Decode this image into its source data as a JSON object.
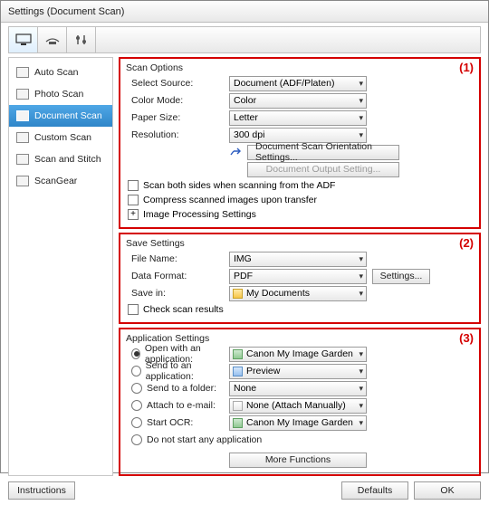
{
  "window": {
    "title": "Settings (Document Scan)"
  },
  "sidebar": {
    "items": [
      {
        "label": "Auto Scan"
      },
      {
        "label": "Photo Scan"
      },
      {
        "label": "Document Scan"
      },
      {
        "label": "Custom Scan"
      },
      {
        "label": "Scan and Stitch"
      },
      {
        "label": "ScanGear"
      }
    ]
  },
  "panel_numbers": {
    "p1": "(1)",
    "p2": "(2)",
    "p3": "(3)"
  },
  "scan_options": {
    "heading": "Scan Options",
    "select_source_label": "Select Source:",
    "select_source_value": "Document (ADF/Platen)",
    "color_mode_label": "Color Mode:",
    "color_mode_value": "Color",
    "paper_size_label": "Paper Size:",
    "paper_size_value": "Letter",
    "resolution_label": "Resolution:",
    "resolution_value": "300 dpi",
    "orientation_btn": "Document Scan Orientation Settings...",
    "output_btn": "Document Output Setting...",
    "chk_both_sides": "Scan both sides when scanning from the ADF",
    "chk_compress": "Compress scanned images upon transfer",
    "image_processing": "Image Processing Settings"
  },
  "save_settings": {
    "heading": "Save Settings",
    "file_name_label": "File Name:",
    "file_name_value": "IMG",
    "data_format_label": "Data Format:",
    "data_format_value": "PDF",
    "settings_btn": "Settings...",
    "save_in_label": "Save in:",
    "save_in_value": "My Documents",
    "chk_check_results": "Check scan results"
  },
  "app_settings": {
    "heading": "Application Settings",
    "open_with_label": "Open with an application:",
    "open_with_value": "Canon My Image Garden",
    "send_app_label": "Send to an application:",
    "send_app_value": "Preview",
    "send_folder_label": "Send to a folder:",
    "send_folder_value": "None",
    "attach_email_label": "Attach to e-mail:",
    "attach_email_value": "None (Attach Manually)",
    "start_ocr_label": "Start OCR:",
    "start_ocr_value": "Canon My Image Garden",
    "do_not_start_label": "Do not start any application",
    "more_functions_btn": "More Functions"
  },
  "footer": {
    "instructions": "Instructions",
    "defaults": "Defaults",
    "ok": "OK"
  }
}
